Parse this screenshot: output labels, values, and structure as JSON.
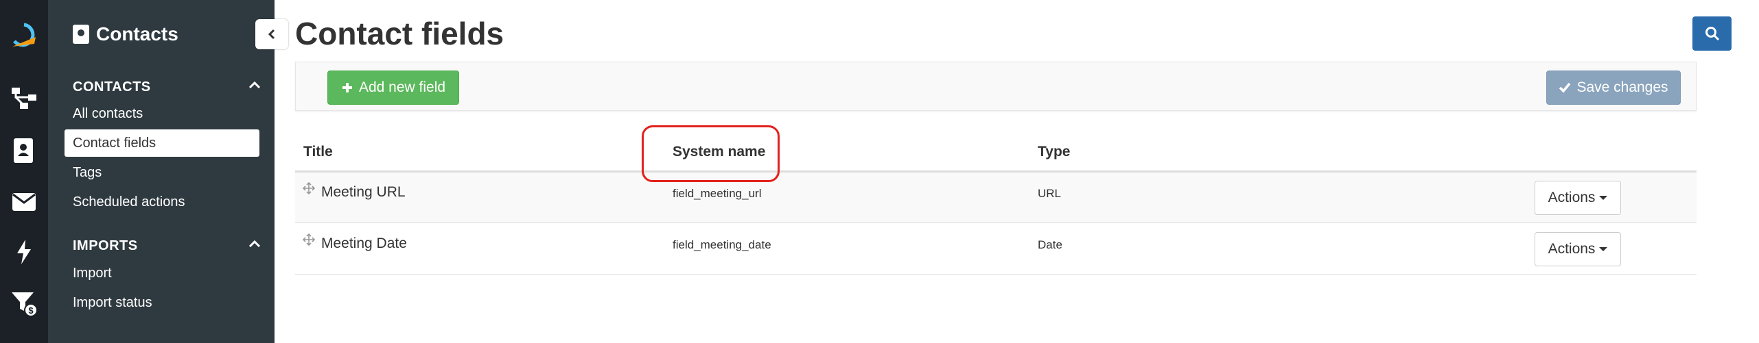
{
  "sidebar": {
    "title": "Contacts",
    "sections": [
      {
        "label": "CONTACTS",
        "items": [
          "All contacts",
          "Contact fields",
          "Tags",
          "Scheduled actions"
        ]
      },
      {
        "label": "IMPORTS",
        "items": [
          "Import",
          "Import status"
        ]
      }
    ],
    "active_item": "Contact fields"
  },
  "rail": {
    "icons": [
      "logo-icon",
      "flow-icon",
      "contacts-icon",
      "email-icon",
      "bolt-icon",
      "funnel-dollar-icon"
    ],
    "accent": "#f39c12"
  },
  "main": {
    "title": "Contact fields",
    "add_label": "Add new field",
    "save_label": "Save changes",
    "columns": [
      "Title",
      "System name",
      "Type"
    ],
    "rows": [
      {
        "title": "Meeting URL",
        "system_name": "field_meeting_url",
        "type": "URL",
        "actions": "Actions"
      },
      {
        "title": "Meeting Date",
        "system_name": "field_meeting_date",
        "type": "Date",
        "actions": "Actions"
      }
    ]
  },
  "colors": {
    "primary": "#2a6cab",
    "success": "#5cb85c",
    "highlight": "#e3211c",
    "sidebar": "#2f3a40",
    "rail": "#1b2126"
  }
}
